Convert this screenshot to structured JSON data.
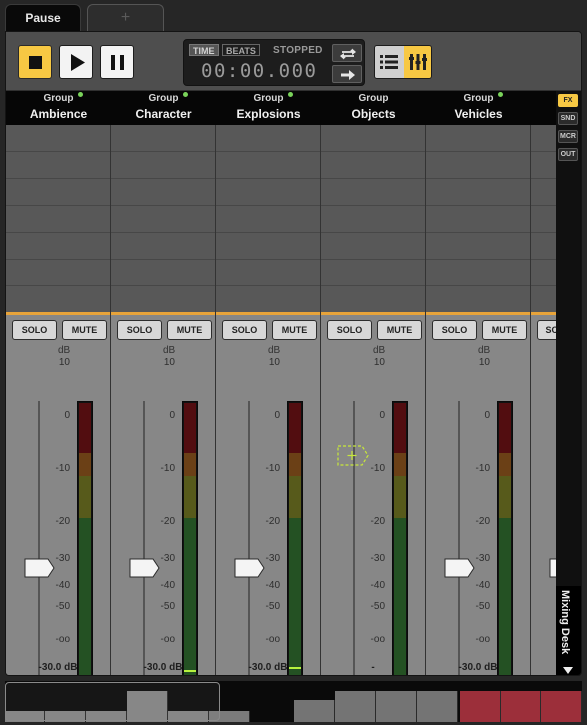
{
  "tabs": [
    {
      "label": "Pause"
    },
    {
      "label": "+"
    }
  ],
  "transport": {
    "mode_time": "TIME",
    "mode_beats": "BEATS",
    "state": "STOPPED",
    "clock": "00:00.000"
  },
  "side_panel": {
    "buttons": [
      "FX",
      "SND",
      "MCR",
      "OUT"
    ],
    "mixing_desk_label": "Mixing Desk"
  },
  "channel_labels": {
    "solo": "SOLO",
    "mute": "MUTE",
    "db_unit": "dB"
  },
  "scale": [
    "10",
    "0",
    "-10",
    "-20",
    "-30",
    "-40",
    "-50",
    "-oo"
  ],
  "channels": [
    {
      "group": "Group",
      "name": "Ambience",
      "level": "-30.0 dB",
      "fader_db": -30,
      "peak_db": null
    },
    {
      "group": "Group",
      "name": "Character",
      "level": "-30.0 dB",
      "fader_db": -30,
      "peak_db": -60
    },
    {
      "group": "Group",
      "name": "Explosions",
      "level": "-30.0 dB",
      "fader_db": -30,
      "peak_db": -59
    },
    {
      "group": "Group",
      "name": "Objects",
      "level": "-",
      "fader_db": null,
      "peak_db": null
    },
    {
      "group": "Group",
      "name": "Vehicles",
      "level": "-30.0 dB",
      "fader_db": -30,
      "peak_db": null
    }
  ],
  "partial_channel": {
    "solo": "SO"
  },
  "colors": {
    "accent": "#f7c843",
    "orange_rule": "#e8a43a",
    "status_dot": "#7ad35a",
    "peak": "#b6f23e"
  }
}
